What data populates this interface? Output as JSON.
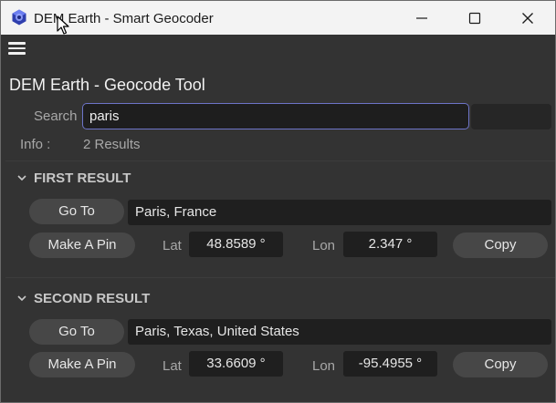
{
  "window": {
    "title": "DEM Earth - Smart Geocoder",
    "icon": "dem-earth-app-icon",
    "controls": {
      "minimize": "minimize-icon",
      "maximize": "maximize-icon",
      "close": "close-icon"
    }
  },
  "menu": {
    "icon": "hamburger-menu-icon"
  },
  "tool": {
    "title": "DEM Earth - Geocode Tool"
  },
  "search": {
    "label": "Search",
    "value": "paris"
  },
  "info": {
    "label": "Info :",
    "value": "2 Results"
  },
  "results": [
    {
      "header": "FIRST RESULT",
      "goto_label": "Go To",
      "place": "Paris, France",
      "pin_label": "Make A Pin",
      "lat_label": "Lat",
      "lat": "48.8589 °",
      "lon_label": "Lon",
      "lon": "2.347 °",
      "copy_label": "Copy"
    },
    {
      "header": "SECOND RESULT",
      "goto_label": "Go To",
      "place": "Paris, Texas, United States",
      "pin_label": "Make A Pin",
      "lat_label": "Lat",
      "lat": "33.6609 °",
      "lon_label": "Lon",
      "lon": "-95.4955 °",
      "copy_label": "Copy"
    }
  ],
  "colors": {
    "panel_bg": "#333333",
    "titlebar_bg": "#f3f3f3",
    "field_bg": "#1f1f1f",
    "button_bg": "#474747",
    "focus_border": "#6d74c8"
  }
}
